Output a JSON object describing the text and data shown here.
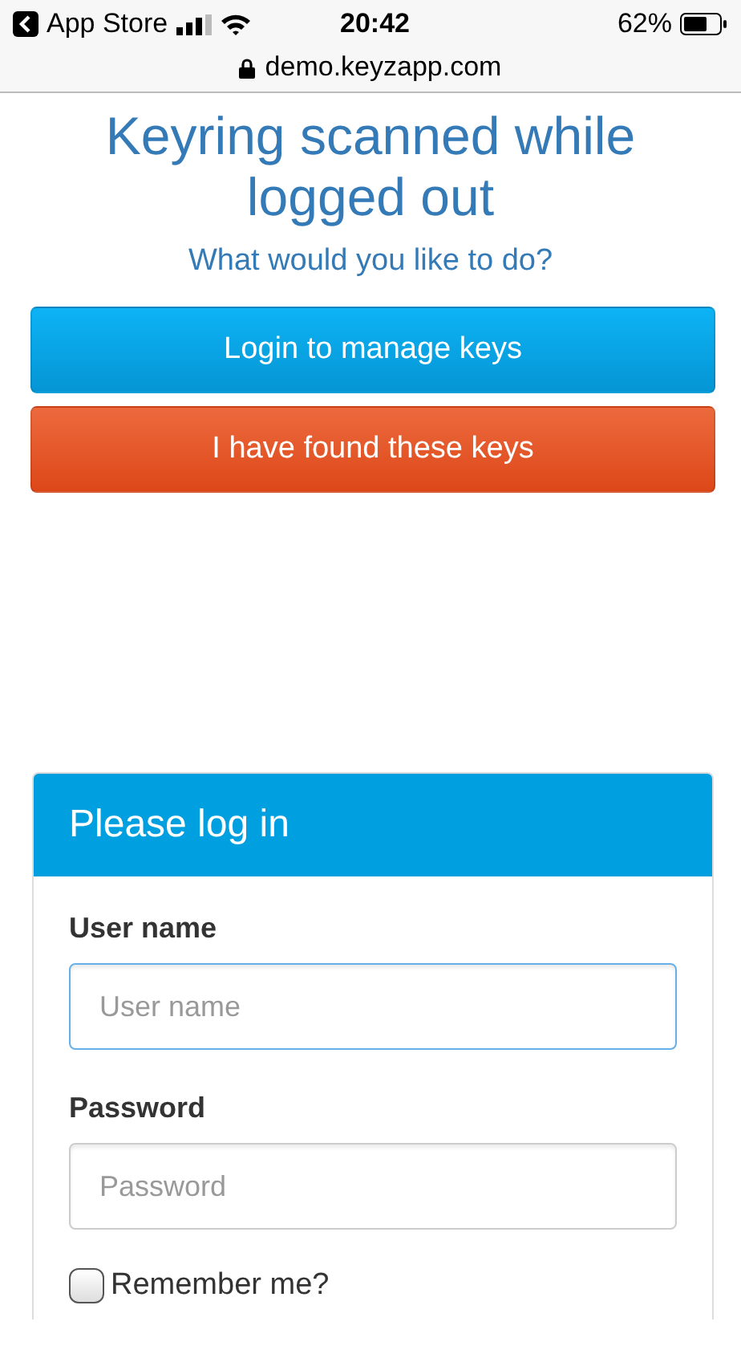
{
  "status_bar": {
    "back_app": "App Store",
    "time": "20:42",
    "battery": "62%",
    "url": "demo.keyzapp.com"
  },
  "heading": "Keyring scanned while logged out",
  "subheading": "What would you like to do?",
  "actions": [
    {
      "label": "Login to manage keys",
      "kind": "primary"
    },
    {
      "label": "I have found these keys",
      "kind": "danger"
    }
  ],
  "login": {
    "title": "Please log in",
    "fields": [
      {
        "label": "User name",
        "placeholder": "User name",
        "focused": true
      },
      {
        "label": "Password",
        "placeholder": "Password",
        "focused": false
      }
    ],
    "remember": {
      "label": "Remember me?",
      "checked": false
    }
  }
}
